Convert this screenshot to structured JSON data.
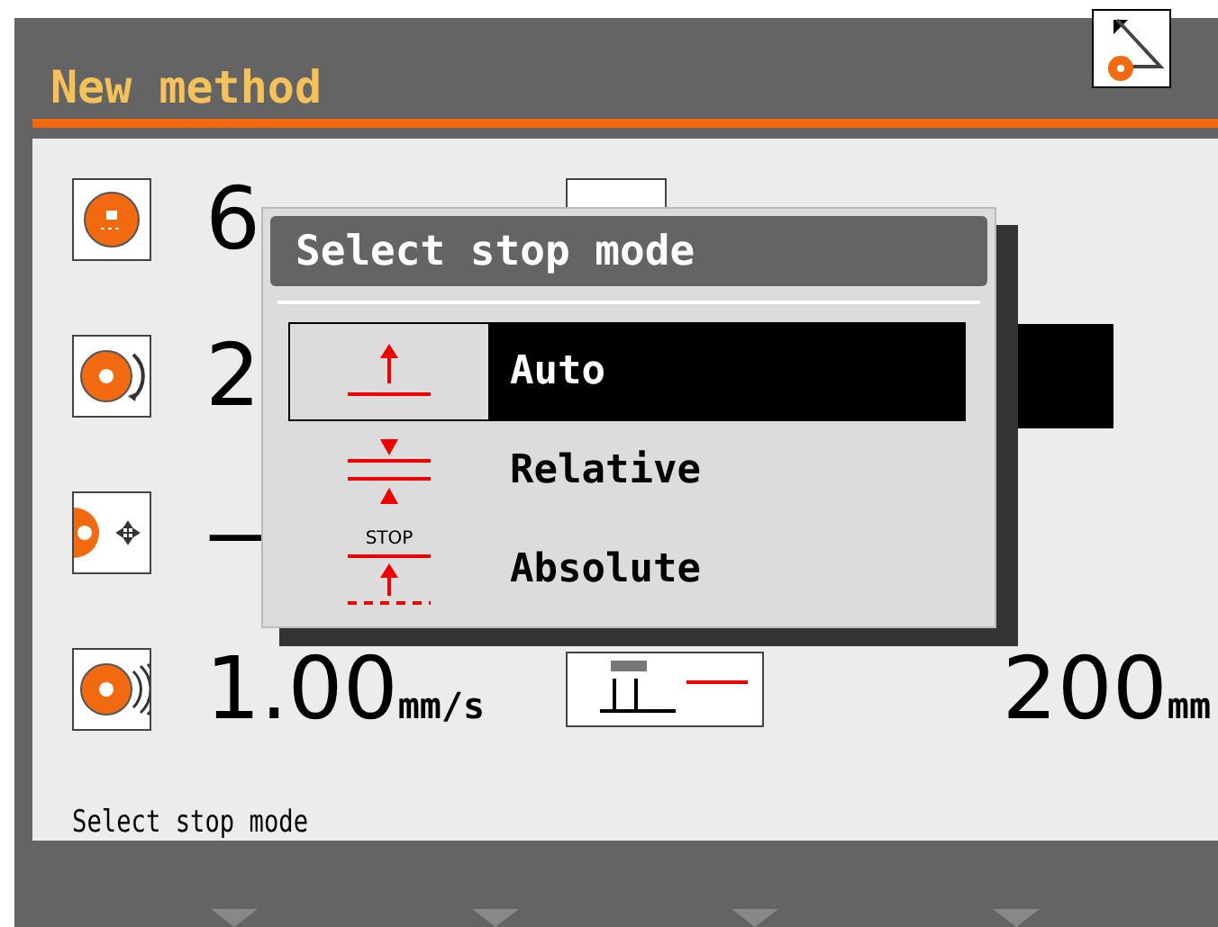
{
  "header": {
    "title": "New method"
  },
  "rows": [
    {
      "kind": "disc",
      "value": "6",
      "right": {
        "kind": "box"
      }
    },
    {
      "kind": "rotate",
      "value": "2",
      "right": {
        "kind": "field",
        "selected": true
      }
    },
    {
      "kind": "move",
      "value": "—"
    },
    {
      "kind": "speed",
      "value": "1.00",
      "unit": "mm/s",
      "right": {
        "kind": "gauge",
        "value": "200",
        "unit": "mm"
      }
    }
  ],
  "dialog": {
    "title": "Select stop mode",
    "options": [
      {
        "label": "Auto",
        "kind": "up",
        "selected": true
      },
      {
        "label": "Relative",
        "kind": "between",
        "selected": false
      },
      {
        "label": "Absolute",
        "kind": "stop",
        "icon_text": "STOP",
        "selected": false
      }
    ]
  },
  "status": "Select stop mode"
}
